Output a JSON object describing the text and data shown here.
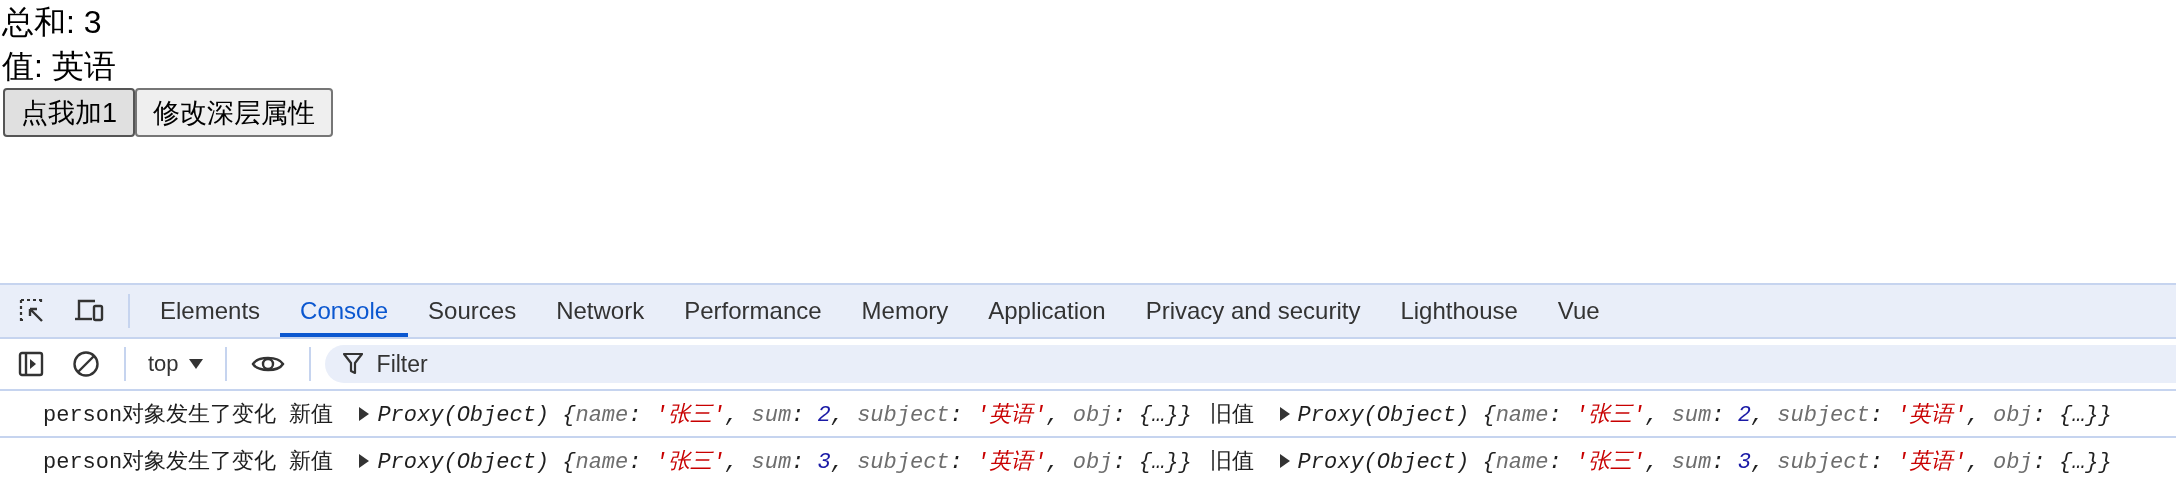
{
  "page": {
    "lines": [
      "总和: 3",
      "值: 英语"
    ],
    "buttons": [
      {
        "label": "点我加1",
        "focused": true
      },
      {
        "label": "修改深层属性",
        "focused": false
      }
    ]
  },
  "devtools": {
    "tabs": [
      {
        "label": "Elements",
        "selected": false
      },
      {
        "label": "Console",
        "selected": true
      },
      {
        "label": "Sources",
        "selected": false
      },
      {
        "label": "Network",
        "selected": false
      },
      {
        "label": "Performance",
        "selected": false
      },
      {
        "label": "Memory",
        "selected": false
      },
      {
        "label": "Application",
        "selected": false
      },
      {
        "label": "Privacy and security",
        "selected": false
      },
      {
        "label": "Lighthouse",
        "selected": false
      },
      {
        "label": "Vue",
        "selected": false
      }
    ],
    "context": "top",
    "filter": {
      "placeholder": "Filter"
    },
    "messages": [
      {
        "text": "person对象发生了变化 新值",
        "new_value": {
          "expanded": false,
          "tokens": [
            {
              "text": "Proxy(Object) ",
              "kind": "label"
            },
            {
              "text": "{",
              "kind": "punct"
            },
            {
              "text": "name",
              "kind": "key"
            },
            {
              "text": ": ",
              "kind": "punct"
            },
            {
              "text": "'张三'",
              "kind": "string"
            },
            {
              "text": ", ",
              "kind": "punct"
            },
            {
              "text": "sum",
              "kind": "key"
            },
            {
              "text": ": ",
              "kind": "punct"
            },
            {
              "text": "2",
              "kind": "number"
            },
            {
              "text": ", ",
              "kind": "punct"
            },
            {
              "text": "subject",
              "kind": "key"
            },
            {
              "text": ": ",
              "kind": "punct"
            },
            {
              "text": "'英语'",
              "kind": "string"
            },
            {
              "text": ", ",
              "kind": "punct"
            },
            {
              "text": "obj",
              "kind": "key"
            },
            {
              "text": ": ",
              "kind": "punct"
            },
            {
              "text": "{…}}",
              "kind": "punct"
            }
          ]
        },
        "old_label": "旧值",
        "old_value": {
          "expanded": false,
          "tokens": [
            {
              "text": "Proxy(Object) ",
              "kind": "label"
            },
            {
              "text": "{",
              "kind": "punct"
            },
            {
              "text": "name",
              "kind": "key"
            },
            {
              "text": ": ",
              "kind": "punct"
            },
            {
              "text": "'张三'",
              "kind": "string"
            },
            {
              "text": ", ",
              "kind": "punct"
            },
            {
              "text": "sum",
              "kind": "key"
            },
            {
              "text": ": ",
              "kind": "punct"
            },
            {
              "text": "2",
              "kind": "number"
            },
            {
              "text": ", ",
              "kind": "punct"
            },
            {
              "text": "subject",
              "kind": "key"
            },
            {
              "text": ": ",
              "kind": "punct"
            },
            {
              "text": "'英语'",
              "kind": "string"
            },
            {
              "text": ", ",
              "kind": "punct"
            },
            {
              "text": "obj",
              "kind": "key"
            },
            {
              "text": ": ",
              "kind": "punct"
            },
            {
              "text": "{…}}",
              "kind": "punct"
            }
          ]
        }
      },
      {
        "text": "person对象发生了变化 新值",
        "new_value": {
          "expanded": false,
          "tokens": [
            {
              "text": "Proxy(Object) ",
              "kind": "label"
            },
            {
              "text": "{",
              "kind": "punct"
            },
            {
              "text": "name",
              "kind": "key"
            },
            {
              "text": ": ",
              "kind": "punct"
            },
            {
              "text": "'张三'",
              "kind": "string"
            },
            {
              "text": ", ",
              "kind": "punct"
            },
            {
              "text": "sum",
              "kind": "key"
            },
            {
              "text": ": ",
              "kind": "punct"
            },
            {
              "text": "3",
              "kind": "number"
            },
            {
              "text": ", ",
              "kind": "punct"
            },
            {
              "text": "subject",
              "kind": "key"
            },
            {
              "text": ": ",
              "kind": "punct"
            },
            {
              "text": "'英语'",
              "kind": "string"
            },
            {
              "text": ", ",
              "kind": "punct"
            },
            {
              "text": "obj",
              "kind": "key"
            },
            {
              "text": ": ",
              "kind": "punct"
            },
            {
              "text": "{…}}",
              "kind": "punct"
            }
          ]
        },
        "old_label": "旧值",
        "old_value": {
          "expanded": false,
          "tokens": [
            {
              "text": "Proxy(Object) ",
              "kind": "label"
            },
            {
              "text": "{",
              "kind": "punct"
            },
            {
              "text": "name",
              "kind": "key"
            },
            {
              "text": ": ",
              "kind": "punct"
            },
            {
              "text": "'张三'",
              "kind": "string"
            },
            {
              "text": ", ",
              "kind": "punct"
            },
            {
              "text": "sum",
              "kind": "key"
            },
            {
              "text": ": ",
              "kind": "punct"
            },
            {
              "text": "3",
              "kind": "number"
            },
            {
              "text": ", ",
              "kind": "punct"
            },
            {
              "text": "subject",
              "kind": "key"
            },
            {
              "text": ": ",
              "kind": "punct"
            },
            {
              "text": "'英语'",
              "kind": "string"
            },
            {
              "text": ", ",
              "kind": "punct"
            },
            {
              "text": "obj",
              "kind": "key"
            },
            {
              "text": ": ",
              "kind": "punct"
            },
            {
              "text": "{…}}",
              "kind": "punct"
            }
          ]
        }
      }
    ]
  }
}
